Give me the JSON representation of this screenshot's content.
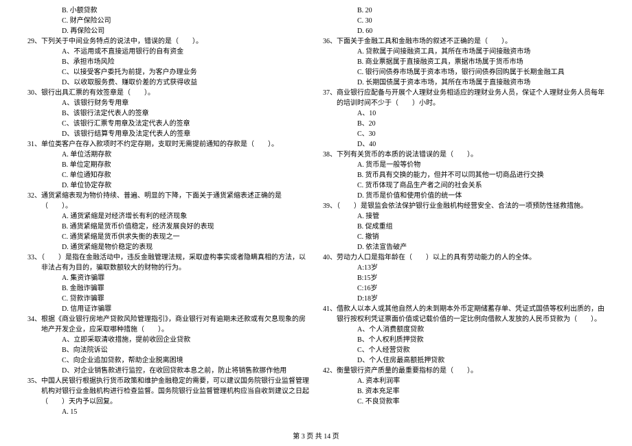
{
  "left": {
    "q28": {
      "B": "B. 小额贷款",
      "C": "C. 财产保险公司",
      "D": "D. 再保险公司"
    },
    "q29": {
      "text": "29、下列关于中间业务特点的说法中，错误的是（　　）。",
      "A": "A、不运用或不直接运用银行的自有资金",
      "B": "B、承担市场风险",
      "C": "C、以接受客户委托为前提，为客户办理业务",
      "D": "D、以收取服务费、赚取价差的方式获得收益"
    },
    "q30": {
      "text": "30、银行出具汇票的有效签章是（　　）。",
      "A": "A、该银行财务专用章",
      "B": "B、该银行法定代表人的签章",
      "C": "C、该银行汇票专用章及法定代表人的签章",
      "D": "D、该银行结算专用章及法定代表人的签章"
    },
    "q31": {
      "text": "31、单位类客户在存入款项时不约定存期，支取时无需提前通知的存款是（　　）。",
      "A": "A. 单位活期存款",
      "B": "B. 单位定期存款",
      "C": "C. 单位通知存款",
      "D": "D. 单位协定存款"
    },
    "q32": {
      "text": "32、通货紧缩表现为物价持续、普遍、明显的下降，下面关于通货紧缩表述正确的是（　　）。",
      "A": "A. 通货紧缩是对经济增长有利的经济现象",
      "B": "B. 通货紧缩是货币价值稳定，经济发展良好的表现",
      "C": "C. 通货紧缩是货币供求失衡的表现之一",
      "D": "D. 通货紧缩是物价稳定的表现"
    },
    "q33": {
      "text": "33、（　　）是指在金融活动中，违反金融管理法规，采取虚构事实或者隐瞒真相的方法，以非法占有为目的，骗取数额较大的财物的行为。",
      "A": "A. 集资诈骗罪",
      "B": "B. 金融诈骗罪",
      "C": "C. 贷款诈骗罪",
      "D": "D. 信用证诈骗罪"
    },
    "q34": {
      "text": "34、根据《商业银行房地产贷款风险管理指引》，商业银行对有逾期未还款或有欠息现象的房地产开发企业，应采取哪种措施（　　）。",
      "A": "A、立即采取清收措施，提前收回企业贷款",
      "B": "B、向法院诉讼",
      "C": "C、向企业追加贷款，帮助企业脱离困境",
      "D": "D、对企业销售款进行监控，在收回贷款本息之前，防止将销售款挪作他用"
    },
    "q35": {
      "text": "35、中国人民银行根据执行货币政策和维护金融稳定的需要，可以建议国务院银行业监督管理机构对银行业金融机构进行检查监督。国务院银行业监督管理机构应当自收到建议之日起（　　）天内予以回复。",
      "A": "A. 15"
    }
  },
  "right": {
    "q35": {
      "B": "B. 20",
      "C": "C. 30",
      "D": "D. 60"
    },
    "q36": {
      "text": "36、下面关于金融工具和金融市场的叙述不正确的是（　　）。",
      "A": "A. 贷款属于间接融资工具，其所在市场属于间接融资市场",
      "B": "B. 商业票据属于直接融资工具，票据市场属于货币市场",
      "C": "C. 银行间债券市场属于资本市场，银行间债券回购属于长期金融工具",
      "D": "D. 长期国债属于资本市场，其所在市场属于直接融资市场"
    },
    "q37": {
      "text": "37、商业银行应配备与开展个人理财业务相适应的理财业务人员，保证个人理财业务人员每年的培训时间不少于（　　）小时。",
      "A": "A、10",
      "B": "B、20",
      "C": "C、30",
      "D": "D、40"
    },
    "q38": {
      "text": "38、下列有关货币的本质的说法错误的是（　　）。",
      "A": "A. 货币是一般等价物",
      "B": "B. 货币具有交换的能力，但并不可以同其他一切商品进行交换",
      "C": "C. 货币体现了商品生产者之间的社会关系",
      "D": "D. 货币是价值和使用价值的统一体"
    },
    "q39": {
      "text": "39、（　　）是银监会依法保护银行业金融机构经营安全、合法的一项预防性拯救措施。",
      "A": "A. 接管",
      "B": "B. 促成重组",
      "C": "C. 撤销",
      "D": "D. 依法宣告破产"
    },
    "q40": {
      "text": "40、劳动力人口是指年龄在（　　）以上的具有劳动能力的人的全体。",
      "A": "A:13岁",
      "B": "B:15岁",
      "C": "C:16岁",
      "D": "D:18岁"
    },
    "q41": {
      "text": "41、借款人以本人或其他自然人的未到期本外币定期储蓄存单、凭证式国债等权利出质的，由银行按权利凭证票面价值或记载价值的一定比例向借款人发放的人民币贷款为（　　）。",
      "A": "A、个人消费额度贷款",
      "B": "B、个人权利质押贷款",
      "C": "C、个人经营贷款",
      "D": "D、个人住房最高额抵押贷款"
    },
    "q42": {
      "text": "42、衡量银行资产质量的最重要指标的是（　　）。",
      "A": "A. 资本利润率",
      "B": "B. 资本充足率",
      "C": "C. 不良贷款率"
    }
  },
  "footer": "第 3 页 共 14 页"
}
